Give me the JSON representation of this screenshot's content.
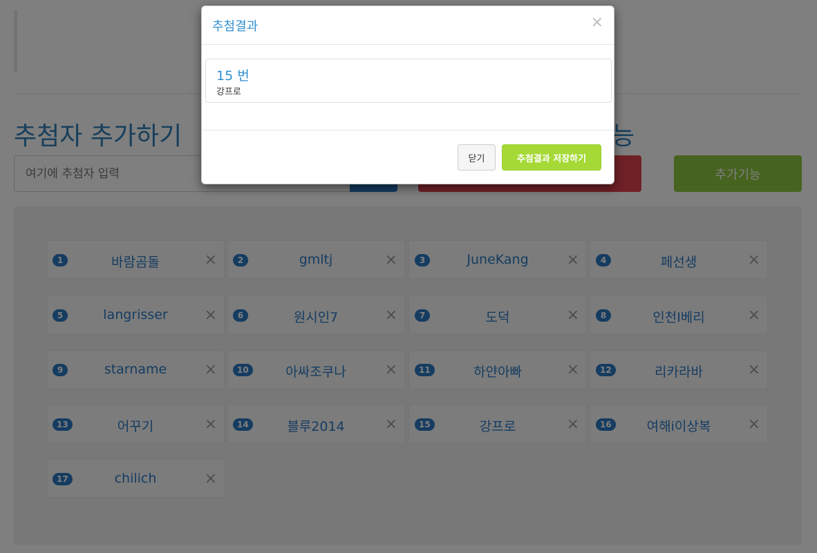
{
  "page": {
    "section_title": "추첨자 추가하기",
    "section_title_right": "능",
    "input_placeholder": "여기에 추첨자 입력",
    "extra_button_label": "추가기능"
  },
  "entries": [
    {
      "num": "1",
      "name": "바람곰돌"
    },
    {
      "num": "2",
      "name": "gmltj"
    },
    {
      "num": "3",
      "name": "JuneKang"
    },
    {
      "num": "4",
      "name": "페선생"
    },
    {
      "num": "5",
      "name": "langrisser"
    },
    {
      "num": "6",
      "name": "원시인7"
    },
    {
      "num": "7",
      "name": "도덕"
    },
    {
      "num": "8",
      "name": "인천I베리"
    },
    {
      "num": "9",
      "name": "starname"
    },
    {
      "num": "10",
      "name": "아싸조쿠나"
    },
    {
      "num": "11",
      "name": "하얀아빠"
    },
    {
      "num": "12",
      "name": "리카라바"
    },
    {
      "num": "13",
      "name": "어꾸기"
    },
    {
      "num": "14",
      "name": "블루2014"
    },
    {
      "num": "15",
      "name": "강프로"
    },
    {
      "num": "16",
      "name": "여해i이상복"
    },
    {
      "num": "17",
      "name": "chilich"
    }
  ],
  "delete_glyph": "×",
  "modal": {
    "title": "추첨결과",
    "close_glyph": "×",
    "result_number": "15 번",
    "result_name": "강프로",
    "close_button": "닫기",
    "save_button": "추첨결과 저장하기"
  },
  "colors": {
    "accent_blue": "#2a78c2",
    "danger_red": "#e0424e",
    "extra_green": "#8dc63f",
    "save_green": "#a5d935"
  }
}
